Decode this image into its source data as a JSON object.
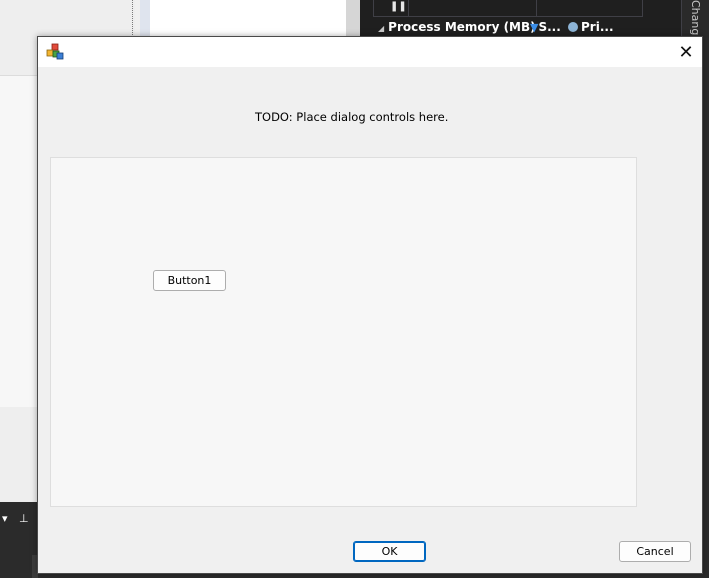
{
  "background": {
    "diagnostics": {
      "section_label": "Process Memory (MB)",
      "legend_items": [
        {
          "label": "S...",
          "icon": "triangle-down-icon",
          "color": "#3b8ee8"
        },
        {
          "label": "Pri...",
          "icon": "circle-icon",
          "color": "#8db4d6"
        }
      ],
      "pause_icon": "pause-icon",
      "side_tab_label": "Change"
    },
    "dock_icons": [
      "dropdown-icon",
      "pin-icon",
      "close-icon"
    ]
  },
  "dialog": {
    "title": "",
    "icon": "app-icon",
    "close_glyph": "✕",
    "instruction_text": "TODO: Place dialog controls here.",
    "panel_button_label": "Button1",
    "ok_label": "OK",
    "cancel_label": "Cancel",
    "colors": {
      "accent": "#0067c0",
      "titlebar": "#ffffff",
      "body": "#f0f0f0"
    }
  }
}
